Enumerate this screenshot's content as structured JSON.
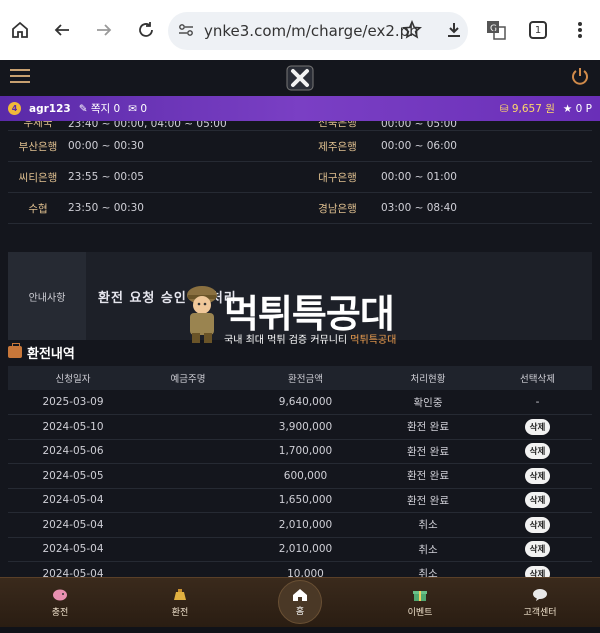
{
  "browser": {
    "url": "ynke3.com/m/charge/ex2.ph",
    "tab_count": "1"
  },
  "user_bar": {
    "level": "4",
    "username": "agr123",
    "notes_label": "쪽지 0",
    "messages_label": "0",
    "balance": "9,657 원",
    "points": "0 P"
  },
  "bank_hours": [
    {
      "bank1": "우체국",
      "time1": "23:40 ~ 00:00, 04:00 ~ 05:00",
      "bank2": "전북은행",
      "time2": "00:00 ~ 05:00"
    },
    {
      "bank1": "부산은행",
      "time1": "00:00 ~ 00:30",
      "bank2": "제주은행",
      "time2": "00:00 ~ 06:00"
    },
    {
      "bank1": "씨티은행",
      "time1": "23:55 ~ 00:05",
      "bank2": "대구은행",
      "time2": "00:00 ~ 01:00"
    },
    {
      "bank1": "수협",
      "time1": "23:50 ~ 00:30",
      "bank2": "경남은행",
      "time2": "03:00 ~ 08:40"
    }
  ],
  "notice": {
    "label": "안내사항",
    "text": "환전 요청 승인 후 처리"
  },
  "watermark": {
    "title": "먹튀특공대",
    "subtitle_main": "국내 최대 먹튀 검증 커뮤니티 ",
    "subtitle_accent": "먹튀특공대"
  },
  "section": {
    "title": "환전내역"
  },
  "table": {
    "headers": [
      "신청일자",
      "예금주명",
      "환전금액",
      "처리현황",
      "선택삭제"
    ],
    "rows": [
      {
        "date": "2025-03-09",
        "name": "",
        "amount": "9,640,000",
        "status": "확인중",
        "action": "-"
      },
      {
        "date": "2024-05-10",
        "name": "",
        "amount": "3,900,000",
        "status": "환전 완료",
        "action": "삭제"
      },
      {
        "date": "2024-05-06",
        "name": "",
        "amount": "1,700,000",
        "status": "환전 완료",
        "action": "삭제"
      },
      {
        "date": "2024-05-05",
        "name": "",
        "amount": "600,000",
        "status": "환전 완료",
        "action": "삭제"
      },
      {
        "date": "2024-05-04",
        "name": "",
        "amount": "1,650,000",
        "status": "환전 완료",
        "action": "삭제"
      },
      {
        "date": "2024-05-04",
        "name": "",
        "amount": "2,010,000",
        "status": "취소",
        "action": "삭제"
      },
      {
        "date": "2024-05-04",
        "name": "",
        "amount": "2,010,000",
        "status": "취소",
        "action": "삭제"
      },
      {
        "date": "2024-05-04",
        "name": "",
        "amount": "10,000",
        "status": "취소",
        "action": "삭제"
      }
    ]
  },
  "bottom_nav": {
    "charge": "충전",
    "exchange": "환전",
    "home": "홈",
    "event": "이벤트",
    "support": "고객센터"
  },
  "colors": {
    "accent_purple": "#6a2fb8",
    "background": "#14161d",
    "bank_name": "#e0c090",
    "nav_brown": "#3a2a1c"
  },
  "icons": [
    "home-icon",
    "back-arrow-icon",
    "forward-arrow-icon",
    "reload-icon",
    "site-settings-icon",
    "bookmark-star-icon",
    "download-icon",
    "translate-icon",
    "tabs-icon",
    "more-menu-icon",
    "hamburger-menu-icon",
    "power-icon"
  ]
}
